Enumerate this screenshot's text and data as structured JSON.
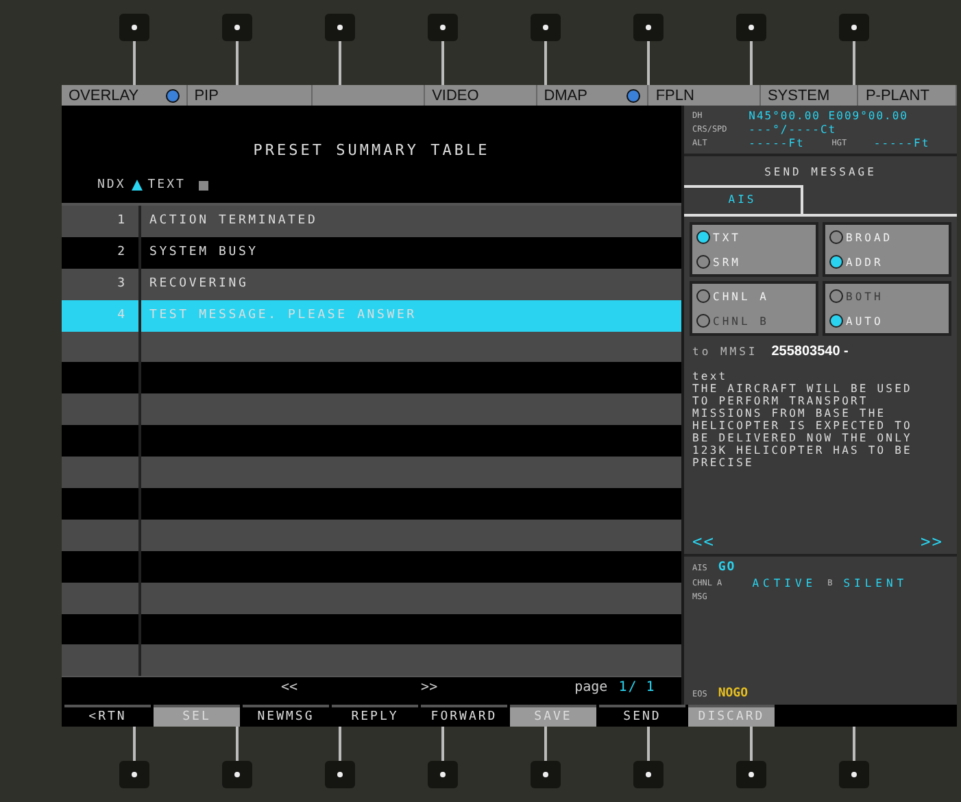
{
  "top_tabs": [
    {
      "label": "OVERLAY",
      "dot": true
    },
    {
      "label": "PIP",
      "dot": false
    },
    {
      "dot": false
    },
    {
      "label": "VIDEO",
      "dot": false
    },
    {
      "label": "DMAP",
      "dot": true
    },
    {
      "label": "FPLN",
      "dot": false
    },
    {
      "label": "SYSTEM",
      "dot": false
    },
    {
      "label": "P-PLANT",
      "dot": false
    }
  ],
  "table": {
    "title": "PRESET SUMMARY TABLE",
    "columns": [
      "NDX",
      "TEXT"
    ],
    "rows": [
      {
        "ndx": "1",
        "text": "ACTION TERMINATED",
        "selected": false
      },
      {
        "ndx": "2",
        "text": "SYSTEM BUSY",
        "selected": false
      },
      {
        "ndx": "3",
        "text": "RECOVERING",
        "selected": false
      },
      {
        "ndx": "4",
        "text": "TEST MESSAGE. PLEASE ANSWER",
        "selected": true
      }
    ]
  },
  "pager": {
    "prev": "<<",
    "next": ">>",
    "label": "page",
    "current": "1/",
    "total": "1"
  },
  "softkeys": [
    {
      "label": "<RTN",
      "lit": false
    },
    {
      "label": "SEL",
      "lit": true
    },
    {
      "label": "NEWMSG",
      "lit": false
    },
    {
      "label": "REPLY",
      "lit": false
    },
    {
      "label": "FORWARD",
      "lit": false
    },
    {
      "label": "SAVE",
      "lit": true
    },
    {
      "label": "SEND",
      "lit": false
    },
    {
      "label": "DISCARD",
      "lit": true
    }
  ],
  "nav_info": {
    "dh_label": "DH",
    "position": "N45°00.00 E009°00.00",
    "crs_label": "CRS/SPD",
    "crs_value": "---°/----Ct",
    "alt_label": "ALT",
    "alt_value": "-----Ft",
    "hgt_label": "HGT",
    "hgt_value": "-----Ft"
  },
  "send_message": {
    "title": "SEND MESSAGE",
    "tab": "AIS",
    "groups": [
      [
        {
          "label": "TXT",
          "selected": true,
          "disabled": false
        },
        {
          "label": "SRM",
          "selected": false,
          "disabled": false
        }
      ],
      [
        {
          "label": "BROAD",
          "selected": false,
          "disabled": false
        },
        {
          "label": "ADDR",
          "selected": true,
          "disabled": false
        }
      ],
      [
        {
          "label": "CHNL A",
          "selected": false,
          "disabled": false
        },
        {
          "label": "CHNL B",
          "selected": false,
          "disabled": true
        }
      ],
      [
        {
          "label": "BOTH",
          "selected": false,
          "disabled": true
        },
        {
          "label": "AUTO",
          "selected": true,
          "disabled": false
        }
      ]
    ],
    "mmsi_label": "to MMSI",
    "mmsi_value": "255803540 -",
    "text_label": "text",
    "text": "THE AIRCRAFT WILL BE USED TO PERFORM TRANSPORT MISSIONS FROM BASE THE HELICOPTER IS EXPECTED TO BE DELIVERED NOW THE ONLY 123K HELICOPTER HAS TO BE PRECISE",
    "prev": "<<",
    "next": ">>"
  },
  "status": {
    "ais_label": "AIS",
    "ais_value": "GO",
    "chnl_label": "CHNL A",
    "chnl_a": "ACTIVE",
    "b_label": "B",
    "chnl_b": "SILENT",
    "msg_label": "MSG",
    "eos_label": "EOS",
    "eos_value": "NOGO"
  }
}
